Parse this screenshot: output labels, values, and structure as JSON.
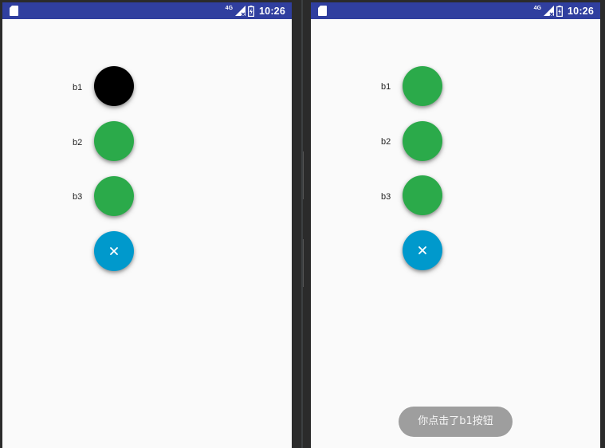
{
  "colors": {
    "status_bar": "#303f9f",
    "fab_mini_default": "#2baa4a",
    "fab_mini_pressed": "#000000",
    "fab_main": "#0099cc",
    "screen_bg": "#fafafa",
    "toast_bg": "#9e9e9e"
  },
  "screens": [
    {
      "status_bar": {
        "network": "4G",
        "time": "10:26",
        "icons": [
          "sim-card-icon",
          "signal-icon",
          "battery-charging-icon"
        ]
      },
      "fab_menu": {
        "items": [
          {
            "label": "b1",
            "state": "pressed"
          },
          {
            "label": "b2",
            "state": "normal"
          },
          {
            "label": "b3",
            "state": "normal"
          }
        ],
        "main_icon": "close-icon"
      },
      "toast": null
    },
    {
      "status_bar": {
        "network": "4G",
        "time": "10:26",
        "icons": [
          "sim-card-icon",
          "signal-icon",
          "battery-charging-icon"
        ]
      },
      "fab_menu": {
        "items": [
          {
            "label": "b1",
            "state": "normal"
          },
          {
            "label": "b2",
            "state": "normal"
          },
          {
            "label": "b3",
            "state": "normal"
          }
        ],
        "main_icon": "close-icon"
      },
      "toast": {
        "text": "你点击了b1按钮"
      }
    }
  ]
}
